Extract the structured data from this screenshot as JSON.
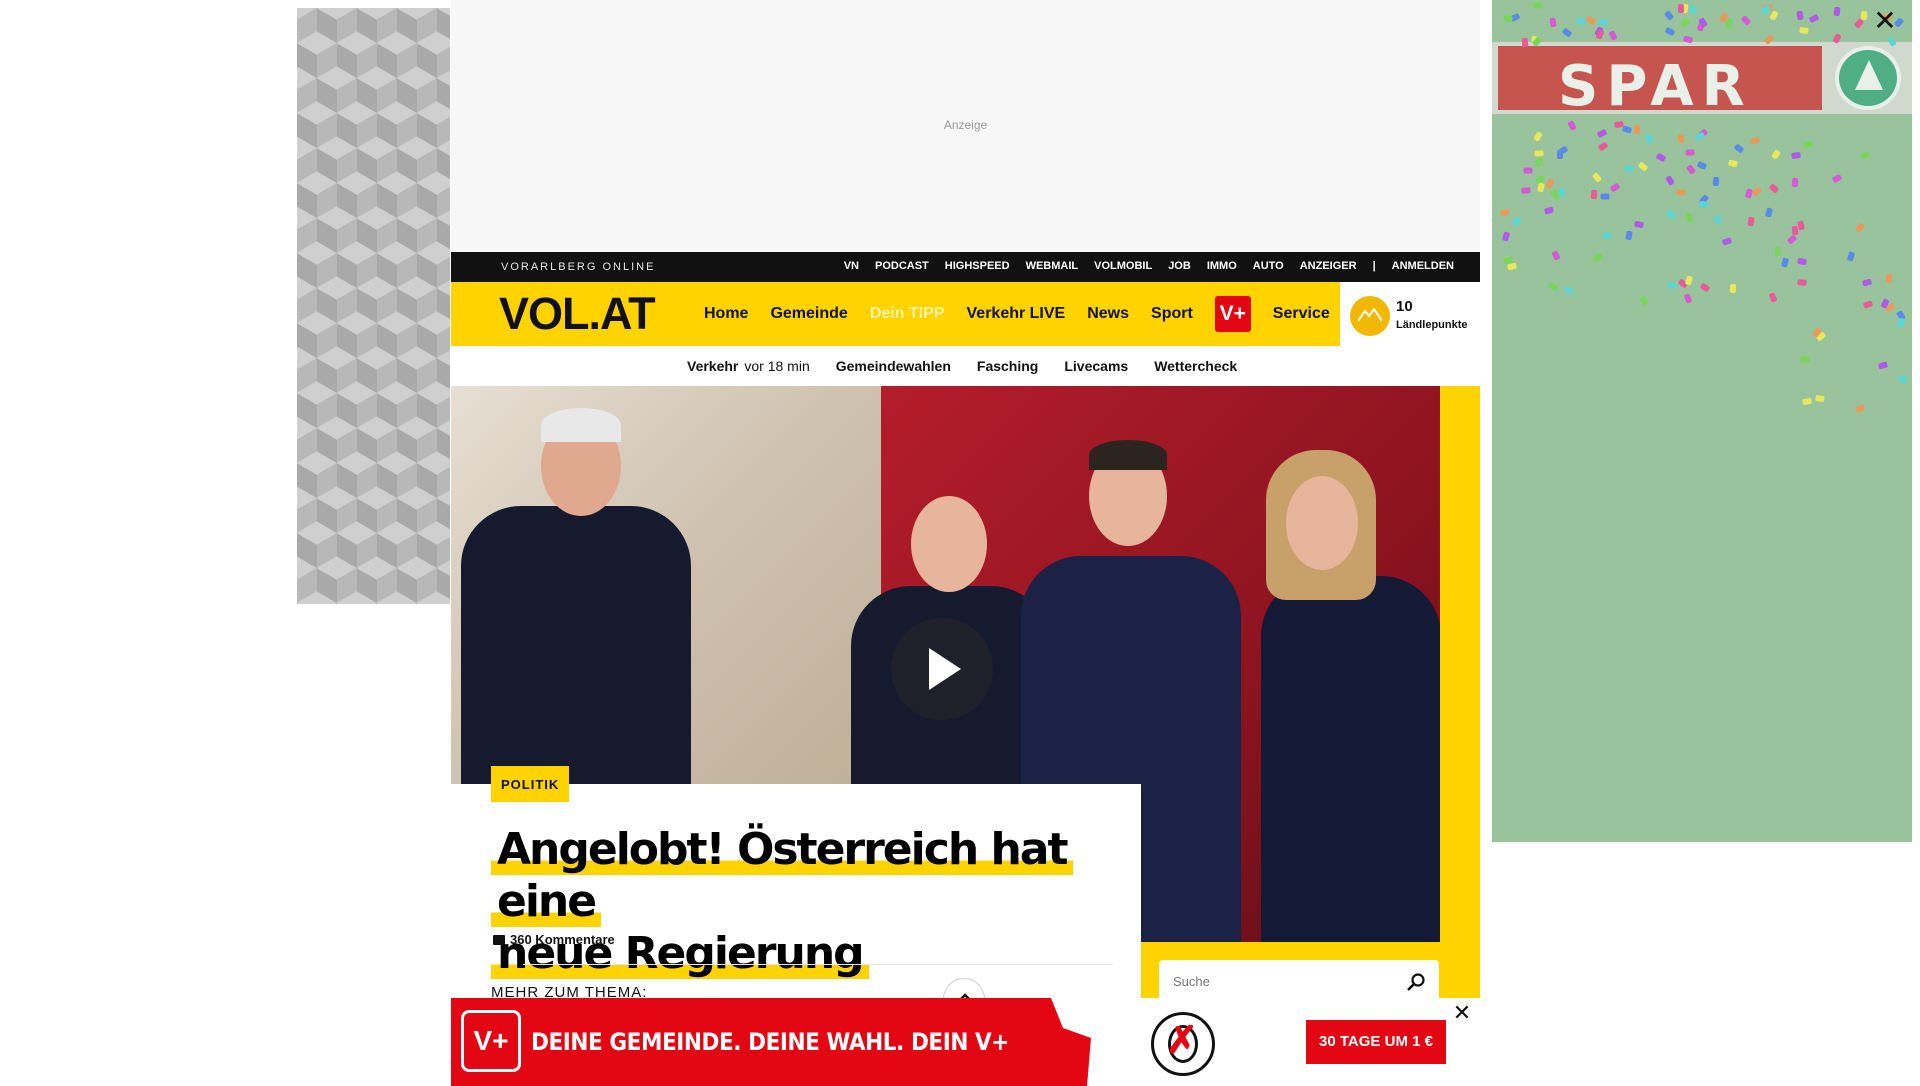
{
  "top_ad": {
    "label": "Anzeige"
  },
  "right_ad": {
    "brand": "SPAR",
    "close_glyph": "✕"
  },
  "topbar": {
    "brand": "VORARLBERG ONLINE",
    "links": [
      "VN",
      "PODCAST",
      "HIGHSPEED",
      "WEBMAIL",
      "VOLMOBIL",
      "JOB",
      "IMMO",
      "AUTO",
      "ANZEIGER",
      "|",
      "ANMELDEN"
    ]
  },
  "mainnav": {
    "logo": "VOL.AT",
    "items": [
      "Home",
      "Gemeinde",
      "Dein TIPP",
      "Verkehr LIVE",
      "News",
      "Sport"
    ],
    "vplus": "V+",
    "service": "Service",
    "points_value": "10",
    "points_label": "Ländlepunkte"
  },
  "subnav": {
    "traffic_label": "Verkehr",
    "traffic_time": "vor 18 min",
    "items": [
      "Gemeindewahlen",
      "Fasching",
      "Livecams",
      "Wettercheck"
    ]
  },
  "article": {
    "category": "POLITIK",
    "headline_line1": "Angelobt! Österreich hat eine",
    "headline_line2": "neue Regierung",
    "comments": "360 Kommentare",
    "more_label": "MEHR ZUM THEMA:"
  },
  "search": {
    "placeholder": "Suche"
  },
  "bottom_banner": {
    "logo": "V+",
    "slogan": "DEINE GEMEINDE. DEINE WAHL. DEIN V+",
    "cta": "30 TAGE UM 1 €",
    "close_glyph": "✕"
  },
  "colors": {
    "brand_yellow": "#ffd300",
    "brand_red": "#e30613",
    "spar_green": "#98c39c"
  }
}
